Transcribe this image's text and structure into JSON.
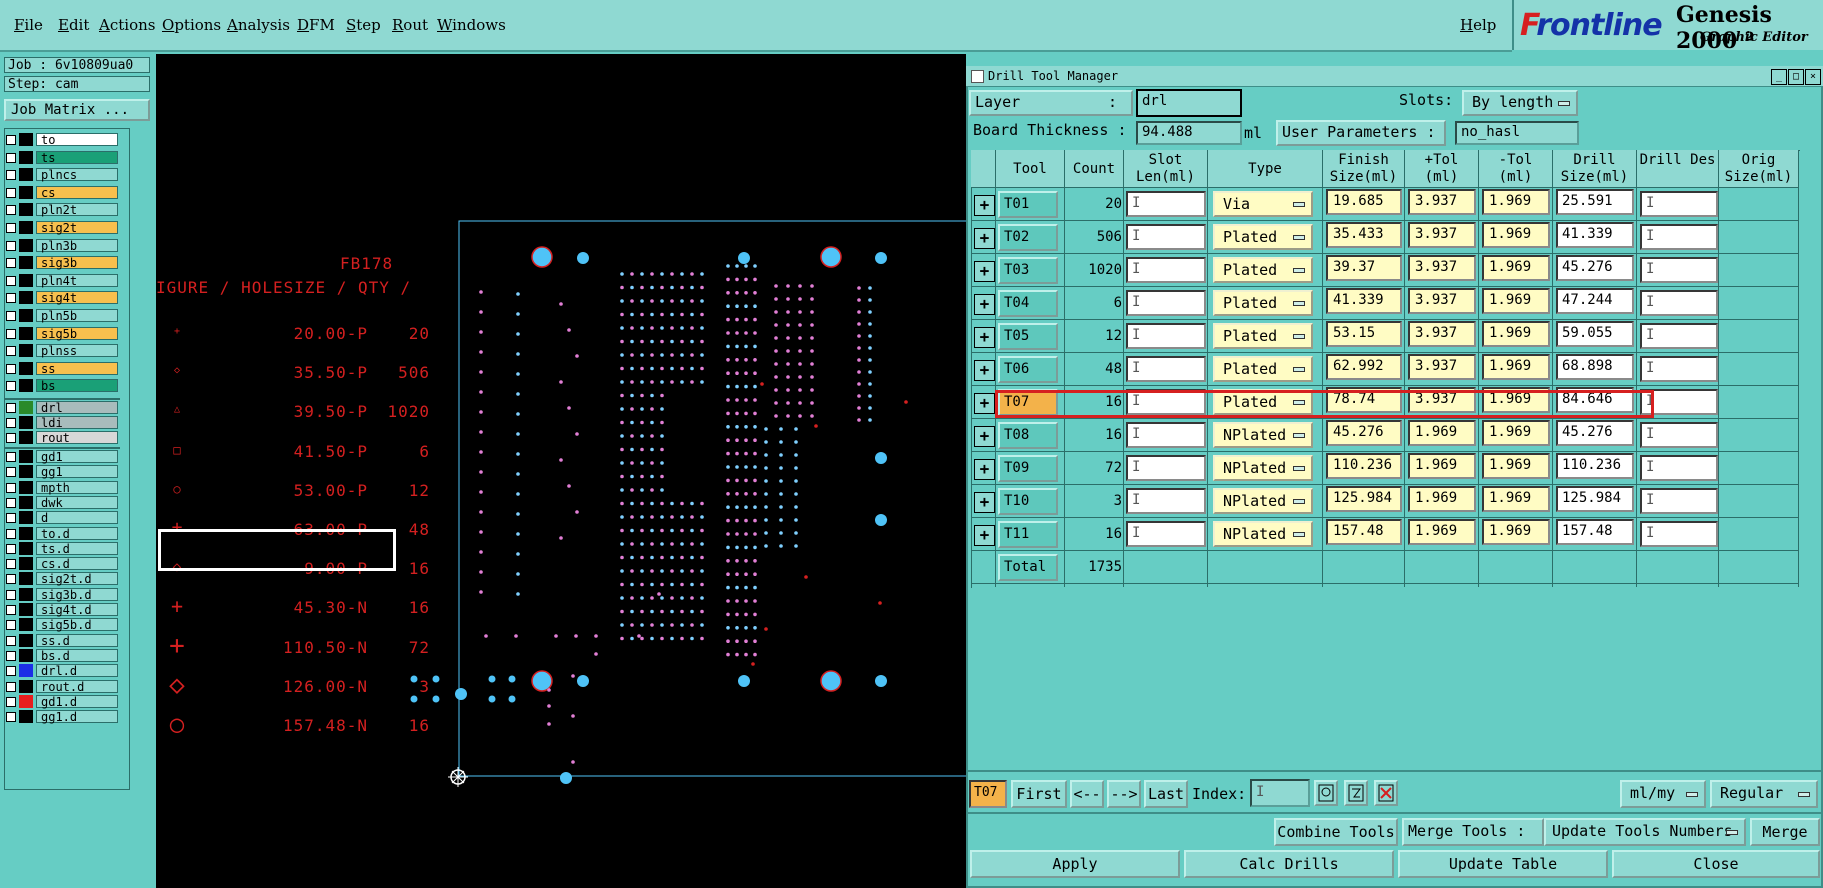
{
  "menubar": {
    "items": [
      "File",
      "Edit",
      "Actions",
      "Options",
      "Analysis",
      "DFM",
      "Step",
      "Rout",
      "Windows"
    ],
    "help": "Help"
  },
  "brand": {
    "logo": "Frontline",
    "title": "Genesis 2000 ²",
    "subtitle": "Graphic Editor"
  },
  "left": {
    "job": "Job : 6v10809ua0",
    "step": "Step: cam",
    "job_matrix": "Job Matrix ...",
    "layers": [
      {
        "name": "to",
        "bg": "#ffffff"
      },
      {
        "name": "ts",
        "bg": "#1aa077"
      },
      {
        "name": "plncs",
        "bg": "#8fd9d2"
      },
      {
        "name": "cs",
        "bg": "#f7c04e"
      },
      {
        "name": "pln2t",
        "bg": "#8fd9d2"
      },
      {
        "name": "sig2t",
        "bg": "#f7c04e"
      },
      {
        "name": "pln3b",
        "bg": "#8fd9d2"
      },
      {
        "name": "sig3b",
        "bg": "#f7c04e"
      },
      {
        "name": "pln4t",
        "bg": "#8fd9d2"
      },
      {
        "name": "sig4t",
        "bg": "#f7c04e"
      },
      {
        "name": "pln5b",
        "bg": "#8fd9d2"
      },
      {
        "name": "sig5b",
        "bg": "#f7c04e"
      },
      {
        "name": "plnss",
        "bg": "#8fd9d2"
      },
      {
        "name": "ss",
        "bg": "#f7c04e"
      },
      {
        "name": "bs",
        "bg": "#1aa077"
      },
      {
        "name": "drl",
        "bg": "#a8bcbc"
      },
      {
        "name": "ldi",
        "bg": "#a8bcbc"
      },
      {
        "name": "rout",
        "bg": "#d8d8d8"
      },
      {
        "name": "gd1",
        "bg": "#8fd9d2"
      },
      {
        "name": "gg1",
        "bg": "#8fd9d2"
      },
      {
        "name": "mpth",
        "bg": "#8fd9d2"
      },
      {
        "name": "dwk",
        "bg": "#8fd9d2"
      },
      {
        "name": "d",
        "bg": "#8fd9d2"
      },
      {
        "name": "to.d",
        "bg": "#8fd9d2"
      },
      {
        "name": "ts.d",
        "bg": "#8fd9d2"
      },
      {
        "name": "cs.d",
        "bg": "#8fd9d2"
      },
      {
        "name": "sig2t.d",
        "bg": "#8fd9d2"
      },
      {
        "name": "sig3b.d",
        "bg": "#8fd9d2"
      },
      {
        "name": "sig4t.d",
        "bg": "#8fd9d2"
      },
      {
        "name": "sig5b.d",
        "bg": "#8fd9d2"
      },
      {
        "name": "ss.d",
        "bg": "#8fd9d2"
      },
      {
        "name": "bs.d",
        "bg": "#8fd9d2"
      },
      {
        "name": "drl.d",
        "bg": "#8fd9d2"
      },
      {
        "name": "rout.d",
        "bg": "#8fd9d2"
      },
      {
        "name": "gd1.d",
        "bg": "#8fd9d2"
      },
      {
        "name": "gg1.d",
        "bg": "#8fd9d2"
      }
    ]
  },
  "legend": {
    "code": "FB178",
    "header": "IGURE / HOLESIZE / QTY /",
    "rows": [
      {
        "size": "20.00-P",
        "qty": "20"
      },
      {
        "size": "35.50-P",
        "qty": "506"
      },
      {
        "size": "39.50-P",
        "qty": "1020"
      },
      {
        "size": "41.50-P",
        "qty": "6"
      },
      {
        "size": "53.00-P",
        "qty": "12"
      },
      {
        "size": "63.00-P",
        "qty": "48"
      },
      {
        "size": "9.00-P",
        "qty": "16"
      },
      {
        "size": "45.30-N",
        "qty": "16"
      },
      {
        "size": "110.50-N",
        "qty": "72"
      },
      {
        "size": "126.00-N",
        "qty": "3"
      },
      {
        "size": "157.48-N",
        "qty": "16"
      }
    ]
  },
  "dialog": {
    "title": "Drill Tool Manager",
    "layer_label": "Layer",
    "layer_colon": ":",
    "layer_value": "drl",
    "slots_label": "Slots:",
    "slots_value": "By length",
    "thickness_label": "Board Thickness :",
    "thickness_value": "94.488",
    "thickness_unit": "ml",
    "user_params_label": "User Parameters :",
    "user_params_value": "no_hasl",
    "columns": [
      "Tool",
      "Count",
      "Slot Len(ml)",
      "Type",
      "Finish Size(ml)",
      "+Tol (ml)",
      "-Tol (ml)",
      "Drill Size(ml)",
      "Drill Des",
      "Orig Size(ml)"
    ],
    "rows": [
      {
        "tool": "T01",
        "count": "20",
        "type": "Via",
        "finish": "19.685",
        "ptol": "3.937",
        "mtol": "1.969",
        "drill": "25.591"
      },
      {
        "tool": "T02",
        "count": "506",
        "type": "Plated",
        "finish": "35.433",
        "ptol": "3.937",
        "mtol": "1.969",
        "drill": "41.339"
      },
      {
        "tool": "T03",
        "count": "1020",
        "type": "Plated",
        "finish": "39.37",
        "ptol": "3.937",
        "mtol": "1.969",
        "drill": "45.276"
      },
      {
        "tool": "T04",
        "count": "6",
        "type": "Plated",
        "finish": "41.339",
        "ptol": "3.937",
        "mtol": "1.969",
        "drill": "47.244"
      },
      {
        "tool": "T05",
        "count": "12",
        "type": "Plated",
        "finish": "53.15",
        "ptol": "3.937",
        "mtol": "1.969",
        "drill": "59.055"
      },
      {
        "tool": "T06",
        "count": "48",
        "type": "Plated",
        "finish": "62.992",
        "ptol": "3.937",
        "mtol": "1.969",
        "drill": "68.898"
      },
      {
        "tool": "T07",
        "count": "16",
        "type": "Plated",
        "finish": "78.74",
        "ptol": "3.937",
        "mtol": "1.969",
        "drill": "84.646"
      },
      {
        "tool": "T08",
        "count": "16",
        "type": "NPlated",
        "finish": "45.276",
        "ptol": "1.969",
        "mtol": "1.969",
        "drill": "45.276"
      },
      {
        "tool": "T09",
        "count": "72",
        "type": "NPlated",
        "finish": "110.236",
        "ptol": "1.969",
        "mtol": "1.969",
        "drill": "110.236"
      },
      {
        "tool": "T10",
        "count": "3",
        "type": "NPlated",
        "finish": "125.984",
        "ptol": "1.969",
        "mtol": "1.969",
        "drill": "125.984"
      },
      {
        "tool": "T11",
        "count": "16",
        "type": "NPlated",
        "finish": "157.48",
        "ptol": "1.969",
        "mtol": "1.969",
        "drill": "157.48"
      }
    ],
    "total_label": "Total",
    "total_count": "1735",
    "nav": {
      "current": "T07",
      "first": "First",
      "prev": "<--",
      "next": "-->",
      "last": "Last",
      "index_label": "Index:",
      "units": "ml/my",
      "mode": "Regular"
    },
    "combine_tools": "Combine Tools",
    "merge_tools_label": "Merge Tools :",
    "merge_option": "Update Tools Numbers",
    "merge": "Merge",
    "apply": "Apply",
    "calc_drills": "Calc Drills",
    "update_table": "Update Table",
    "close": "Close"
  },
  "colors": {
    "panel": "#66cdc4",
    "accent_selected": "#f3b24a",
    "highlight": "#d62020",
    "pad": "#4fc3f7"
  }
}
